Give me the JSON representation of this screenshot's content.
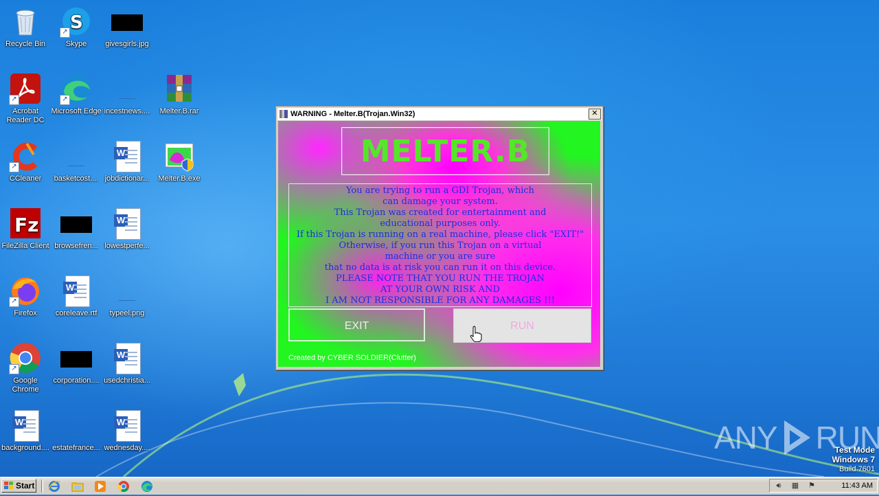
{
  "desktop": {
    "icons": [
      {
        "label": "Recycle Bin"
      },
      {
        "label": "Skype"
      },
      {
        "label": "givesgirls.jpg"
      },
      {
        "label": "Acrobat Reader DC"
      },
      {
        "label": "Microsoft Edge"
      },
      {
        "label": "incestnews...."
      },
      {
        "label": "Melter.B.rar"
      },
      {
        "label": "CCleaner"
      },
      {
        "label": "basketcost...."
      },
      {
        "label": "jobdictionar..."
      },
      {
        "label": "Melter.B.exe"
      },
      {
        "label": "FileZilla Client"
      },
      {
        "label": "browsefren..."
      },
      {
        "label": "lowestperfe..."
      },
      {
        "label": "Firefox"
      },
      {
        "label": "coreleave.rtf"
      },
      {
        "label": "typeel.png"
      },
      {
        "label": "Google Chrome"
      },
      {
        "label": "corporation...."
      },
      {
        "label": "usedchristia..."
      },
      {
        "label": "background...."
      },
      {
        "label": "estatefrance..."
      },
      {
        "label": "wednesday...."
      }
    ]
  },
  "dialog": {
    "title": "WARNING - Melter.B(Trojan.Win32)",
    "close_label": "✕",
    "logo_text": "MELTER.B",
    "message_lines": [
      "You are trying to run a GDI Trojan, which",
      "can damage your system.",
      "This Trojan was created for entertainment and",
      "educational purposes only.",
      "If this Trojan is running on a real machine, please click \"EXIT!\"",
      "Otherwise, if you run this Trojan on a virtual",
      "machine or you are sure",
      "that no data is at risk you can run it on this device.",
      "PLEASE NOTE THAT YOU RUN THE TROJAN",
      "AT YOUR OWN RISK AND",
      "I AM NOT RESPONSIBLE FOR ANY DAMAGES !!!"
    ],
    "exit_label": "EXIT",
    "run_label": "RUN",
    "credit": "Created by CYBER SOLDIER(Clutter)"
  },
  "watermark": {
    "left": "ANY",
    "right": "RUN"
  },
  "test_mode": {
    "line1": "Test Mode",
    "line2": "Windows 7",
    "line3": "Build 7601"
  },
  "taskbar": {
    "start_label": "Start",
    "pinned": [
      "internet-explorer-icon",
      "explorer-icon",
      "media-player-icon",
      "chrome-icon",
      "edge-icon"
    ],
    "clock": "11:43 AM"
  },
  "colors": {
    "desktop_bg": "#1f7ad6",
    "trojan_green": "#22f520",
    "trojan_magenta": "#ff00ff",
    "message_text": "#1a2ee0"
  }
}
